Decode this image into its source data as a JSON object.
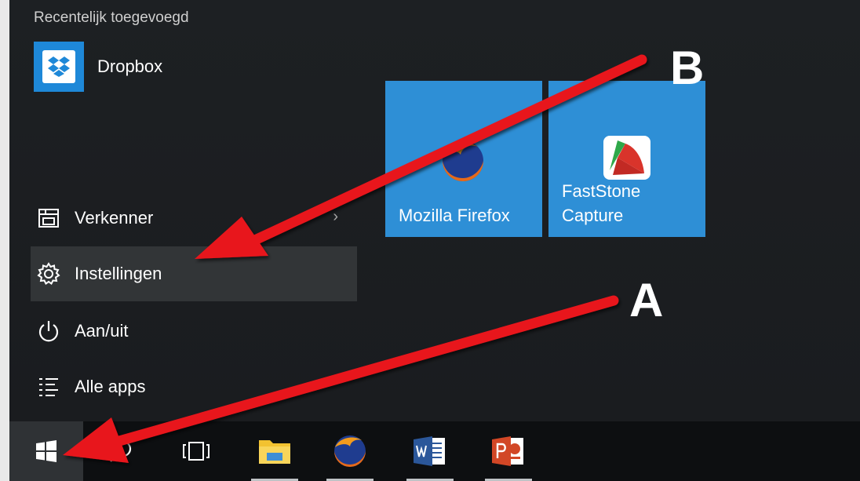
{
  "start_menu": {
    "recent_header": "Recentelijk toegevoegd",
    "recent_app": {
      "name": "Dropbox",
      "icon": "dropbox-icon"
    },
    "items": [
      {
        "label": "Verkenner",
        "icon": "file-explorer-icon",
        "has_submenu": true,
        "chevron": "›"
      },
      {
        "label": "Instellingen",
        "icon": "gear-icon",
        "highlighted": true
      },
      {
        "label": "Aan/uit",
        "icon": "power-icon"
      },
      {
        "label": "Alle apps",
        "icon": "all-apps-list-icon"
      }
    ],
    "tiles": [
      {
        "label": "Mozilla Firefox",
        "icon": "firefox-icon"
      },
      {
        "label": "FastStone\nCapture",
        "icon": "faststone-capture-icon"
      }
    ],
    "tile_color": "#2e8fd6"
  },
  "taskbar": {
    "items": [
      {
        "name": "start",
        "icon": "windows-logo-icon"
      },
      {
        "name": "search",
        "icon": "search-icon"
      },
      {
        "name": "task-view",
        "icon": "task-view-icon"
      },
      {
        "name": "file-explorer",
        "icon": "folder-icon"
      },
      {
        "name": "firefox",
        "icon": "firefox-icon"
      },
      {
        "name": "word",
        "icon": "word-icon"
      },
      {
        "name": "powerpoint",
        "icon": "powerpoint-icon"
      }
    ]
  },
  "annotations": {
    "label_a": "A",
    "label_b": "B",
    "arrow_color": "#e8141b"
  }
}
